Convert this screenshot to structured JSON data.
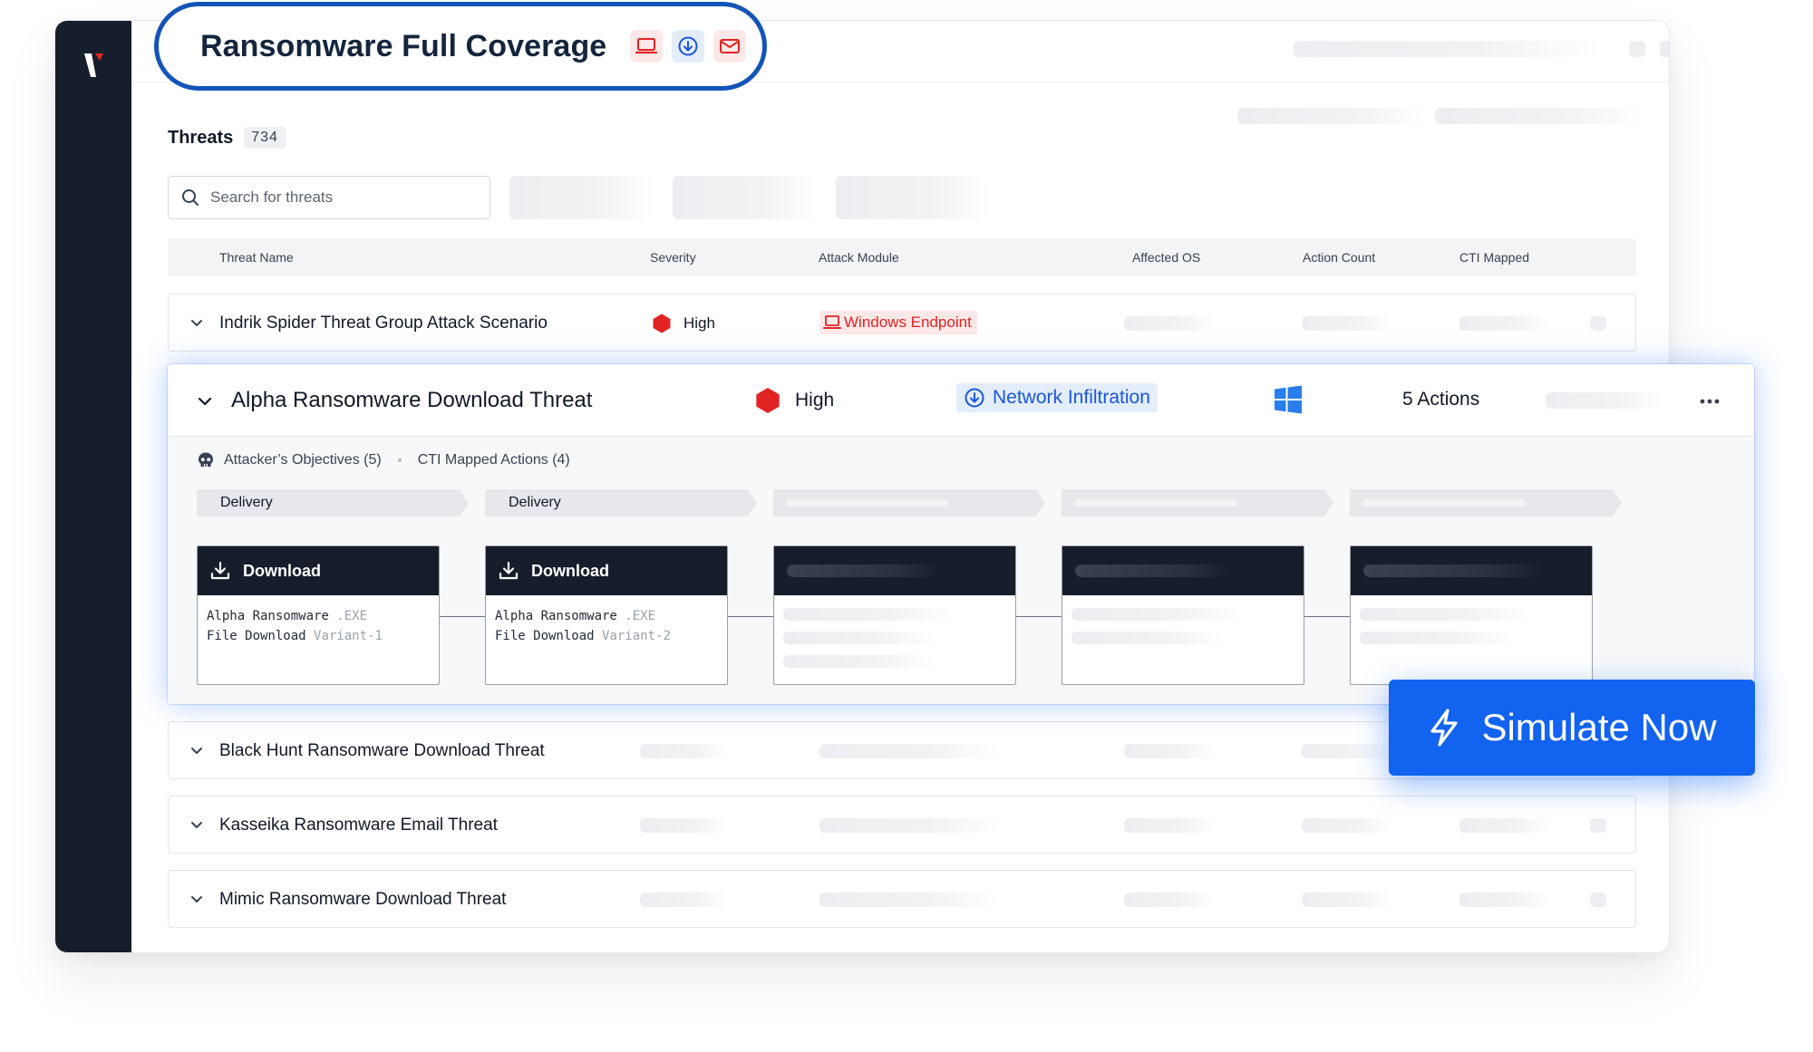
{
  "header": {
    "title": "Ransomware Full Coverage",
    "icons": [
      "laptop-icon",
      "download-circle-icon",
      "email-icon"
    ]
  },
  "threats": {
    "label": "Threats",
    "count": "734"
  },
  "search": {
    "placeholder": "Search for threats"
  },
  "table": {
    "columns": [
      "Threat Name",
      "Severity",
      "Attack Module",
      "Affected OS",
      "Action Count",
      "CTI Mapped"
    ],
    "rows": [
      {
        "name": "Indrik Spider Threat Group Attack Scenario",
        "severity": "High",
        "module": "Windows Endpoint"
      },
      {
        "name": "Black Hunt Ransomware Download Threat"
      },
      {
        "name": "Kasseika Ransomware Email Threat"
      },
      {
        "name": "Mimic Ransomware Download Threat"
      }
    ]
  },
  "expanded": {
    "name": "Alpha Ransomware Download Threat",
    "severity": "High",
    "module": "Network Infiltration",
    "os_icon": "windows-icon",
    "actions": "5 Actions",
    "meta_objectives": "Attacker’s Objectives (5)",
    "meta_cti": "CTI Mapped Actions (4)",
    "stages": [
      "Delivery",
      "Delivery"
    ],
    "nodes": [
      {
        "title": "Download",
        "line1_a": "Alpha Ransomware",
        "line1_b": ".EXE",
        "line2_a": "File Download",
        "line2_b": "Variant-1"
      },
      {
        "title": "Download",
        "line1_a": "Alpha Ransomware",
        "line1_b": ".EXE",
        "line2_a": "File Download",
        "line2_b": "Variant-2"
      }
    ]
  },
  "cta": {
    "label": "Simulate Now"
  },
  "colors": {
    "sidebar": "#161d2b",
    "accent_blue": "#1163f0",
    "pill_border": "#1454b8",
    "severity_high": "#e02424",
    "module_red_bg": "#fde8e8",
    "module_blue_bg": "#e3edfc",
    "windows_blue": "#2b7de9"
  }
}
